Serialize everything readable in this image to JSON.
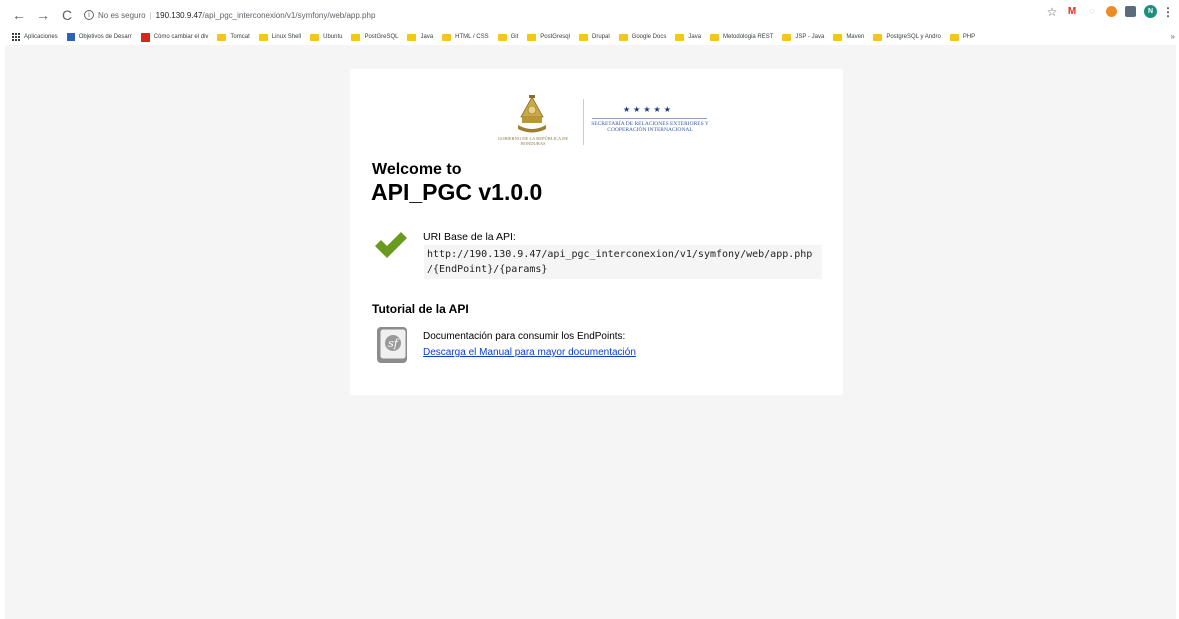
{
  "browser": {
    "nav": {
      "back": "←",
      "forward": "→",
      "reload": "C"
    },
    "url": {
      "security_text": "No es seguro",
      "host": "190.130.9.47",
      "path": "/api_pgc_interconexion/v1/symfony/web/app.php"
    },
    "extensions": {
      "gmail": "M",
      "avatar": "N"
    }
  },
  "bookmarks": [
    {
      "label": "Aplicaciones",
      "icon": "apps-icon"
    },
    {
      "label": "Objetivos de Desarr",
      "icon": "favicon-blue"
    },
    {
      "label": "Cómo cambiar el div",
      "icon": "favicon-red"
    },
    {
      "label": "Tomcat",
      "icon": "folder-icon"
    },
    {
      "label": "Linux Shell",
      "icon": "folder-icon"
    },
    {
      "label": "Ubuntu",
      "icon": "folder-icon"
    },
    {
      "label": "PostGreSQL",
      "icon": "folder-icon"
    },
    {
      "label": "Java",
      "icon": "folder-icon"
    },
    {
      "label": "HTML / CSS",
      "icon": "folder-icon"
    },
    {
      "label": "Git",
      "icon": "folder-icon"
    },
    {
      "label": "PostGresql",
      "icon": "folder-icon"
    },
    {
      "label": "Drupal",
      "icon": "folder-icon"
    },
    {
      "label": "Google Docs",
      "icon": "folder-icon"
    },
    {
      "label": "Java",
      "icon": "folder-icon"
    },
    {
      "label": "Metodologia REST",
      "icon": "folder-icon"
    },
    {
      "label": "JSP - Java",
      "icon": "folder-icon"
    },
    {
      "label": "Maven",
      "icon": "folder-icon"
    },
    {
      "label": "PostgreSQL y Andro",
      "icon": "folder-icon"
    },
    {
      "label": "PHP",
      "icon": "folder-icon"
    }
  ],
  "bookmarks_more": "»",
  "logos": {
    "government": "Gobierno de la República de Honduras",
    "stars": "★★★★★",
    "secretariat": "Secretaría de Relaciones Exteriores y Cooperación Internacional"
  },
  "welcome": {
    "line1": "Welcome to",
    "title": "API_PGC v1.0.0"
  },
  "uri": {
    "label": "URI Base de la API:",
    "line1": "http://190.130.9.47/api_pgc_interconexion/v1/symfony/web/app.php",
    "line2": "/{EndPoint}/{params}"
  },
  "tutorial": {
    "heading": "Tutorial de la API",
    "description": "Documentación para consumir los EndPoints:",
    "link_text": "Descarga el Manual para mayor documentación"
  },
  "colors": {
    "check": "#6a9a1f",
    "link": "#0b40d8",
    "background": "#f5f5f5"
  }
}
